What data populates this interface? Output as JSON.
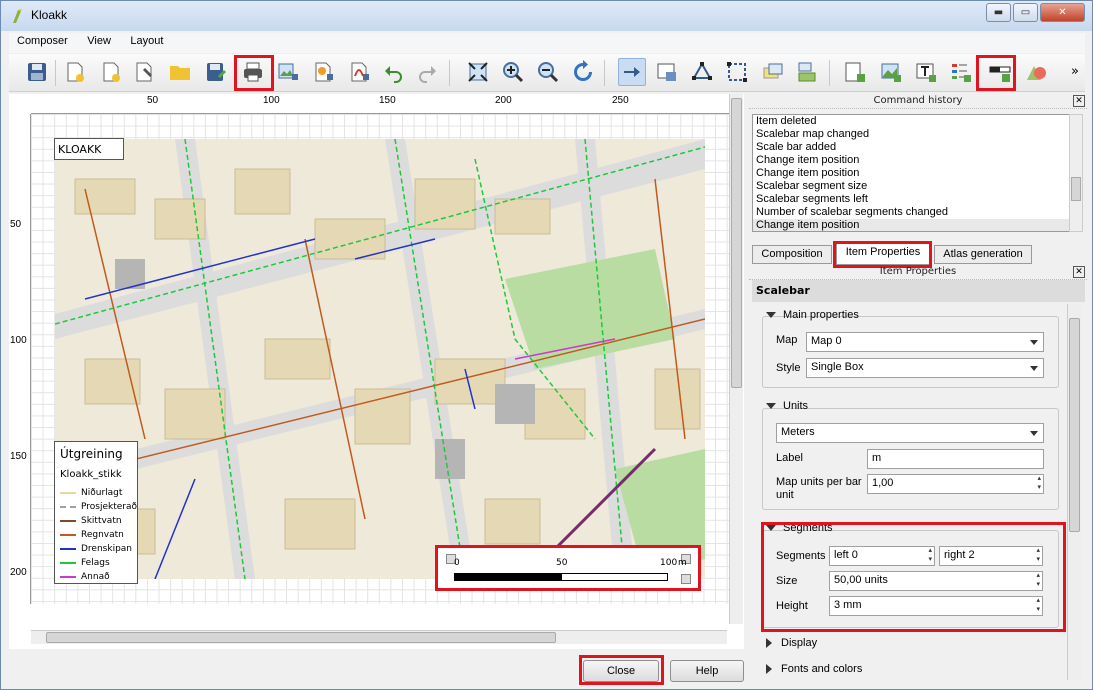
{
  "window": {
    "title": "Kloakk",
    "minimize": "▬",
    "maximize": "▭",
    "close": "✕"
  },
  "menu": [
    "Composer",
    "View",
    "Layout"
  ],
  "toolbar": {
    "more": "»"
  },
  "rulers": {
    "top": [
      "50",
      "100",
      "150",
      "200",
      "250"
    ],
    "left": [
      "50",
      "100",
      "150",
      "200"
    ]
  },
  "map": {
    "label": "KLOAKK",
    "legend": {
      "title": "Útgreining",
      "subtitle": "Kloakk_stikk",
      "items": [
        {
          "label": "Niðurlagt",
          "color": "#e8d89a"
        },
        {
          "label": "Prosjekterað",
          "color": "#a0a0a0"
        },
        {
          "label": "Skittvatn",
          "color": "#7b4a2a"
        },
        {
          "label": "Regnvatn",
          "color": "#c05a1e"
        },
        {
          "label": "Drenskipan",
          "color": "#2233cc"
        },
        {
          "label": "Felags",
          "color": "#1fc83a"
        },
        {
          "label": "Annað",
          "color": "#c83cc8"
        }
      ]
    },
    "scalebar": {
      "ticks": [
        "0",
        "50",
        "100"
      ],
      "unit": "m"
    }
  },
  "history": {
    "title": "Command history",
    "items": [
      "Item deleted",
      "Scalebar map changed",
      "Scale bar added",
      "Change item position",
      "Change item position",
      "Scalebar segment size",
      "Scalebar segments left",
      "Number of scalebar segments changed",
      "Change item position"
    ],
    "selected_index": 8
  },
  "tabs": [
    "Composition",
    "Item Properties",
    "Atlas generation"
  ],
  "item_properties": {
    "title": "Item Properties",
    "section": "Scalebar",
    "main": {
      "heading": "Main properties",
      "map_label": "Map",
      "map_value": "Map 0",
      "style_label": "Style",
      "style_value": "Single Box"
    },
    "units": {
      "heading": "Units",
      "unit_value": "Meters",
      "label_label": "Label",
      "label_value": "m",
      "mupb_label": "Map units per bar unit",
      "mupb_value": "1,00"
    },
    "segments": {
      "heading": "Segments",
      "segments_label": "Segments",
      "left_value": "left 0",
      "right_value": "right 2",
      "size_label": "Size",
      "size_value": "50,00 units",
      "height_label": "Height",
      "height_value": "3 mm"
    },
    "display": "Display",
    "fonts": "Fonts and colors"
  },
  "buttons": {
    "close": "Close",
    "help": "Help"
  },
  "highlight_color": "#e0141e"
}
